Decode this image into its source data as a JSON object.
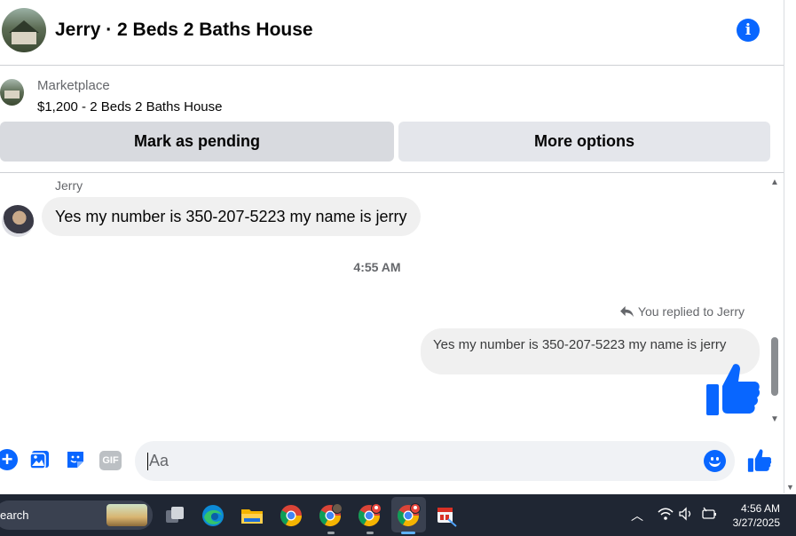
{
  "header": {
    "title": "Jerry · 2 Beds 2 Baths House",
    "info_icon": "info-icon"
  },
  "listing": {
    "label": "Marketplace",
    "item": "$1,200 - 2 Beds 2 Baths House",
    "buttons": {
      "pending": "Mark as pending",
      "more": "More options"
    }
  },
  "messages": {
    "sender": "Jerry",
    "incoming_text": "Yes my number is 350-207-5223 my name is jerry",
    "timestamp": "4:55 AM",
    "replied_label": "You replied to Jerry",
    "outgoing_text": "Yes my number is 350-207-5223 my name is jerry",
    "sent_reaction": "thumbs-up-icon"
  },
  "composer": {
    "placeholder": "Aa",
    "gif_label": "GIF",
    "icons": [
      "plus-icon",
      "image-icon",
      "sticker-icon",
      "gif-icon",
      "emoji-icon",
      "thumbs-up-icon"
    ]
  },
  "taskbar": {
    "search_label": "earch",
    "apps": [
      "task-view-icon",
      "edge-icon",
      "file-explorer-icon",
      "chrome-icon",
      "chrome-profile-icon",
      "chrome-profile-icon",
      "chrome-profile-icon",
      "snipping-tool-icon"
    ],
    "tray_icons": [
      "chevron-up-icon",
      "wifi-icon",
      "volume-icon",
      "battery-icon"
    ],
    "time": "4:56 AM",
    "date": "3/27/2025"
  },
  "colors": {
    "accent": "#0866ff",
    "bubble": "#f0f0f0",
    "taskbar": "#1f2633"
  }
}
